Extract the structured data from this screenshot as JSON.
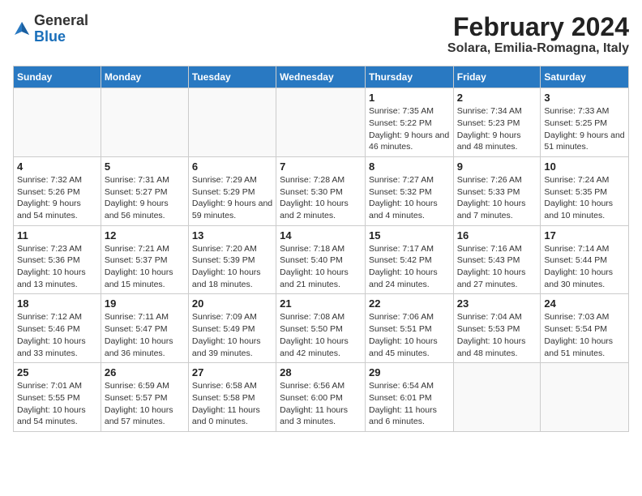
{
  "logo": {
    "general": "General",
    "blue": "Blue"
  },
  "header": {
    "month_year": "February 2024",
    "location": "Solara, Emilia-Romagna, Italy"
  },
  "weekdays": [
    "Sunday",
    "Monday",
    "Tuesday",
    "Wednesday",
    "Thursday",
    "Friday",
    "Saturday"
  ],
  "weeks": [
    [
      {
        "day": "",
        "info": ""
      },
      {
        "day": "",
        "info": ""
      },
      {
        "day": "",
        "info": ""
      },
      {
        "day": "",
        "info": ""
      },
      {
        "day": "1",
        "info": "Sunrise: 7:35 AM\nSunset: 5:22 PM\nDaylight: 9 hours and 46 minutes."
      },
      {
        "day": "2",
        "info": "Sunrise: 7:34 AM\nSunset: 5:23 PM\nDaylight: 9 hours and 48 minutes."
      },
      {
        "day": "3",
        "info": "Sunrise: 7:33 AM\nSunset: 5:25 PM\nDaylight: 9 hours and 51 minutes."
      }
    ],
    [
      {
        "day": "4",
        "info": "Sunrise: 7:32 AM\nSunset: 5:26 PM\nDaylight: 9 hours and 54 minutes."
      },
      {
        "day": "5",
        "info": "Sunrise: 7:31 AM\nSunset: 5:27 PM\nDaylight: 9 hours and 56 minutes."
      },
      {
        "day": "6",
        "info": "Sunrise: 7:29 AM\nSunset: 5:29 PM\nDaylight: 9 hours and 59 minutes."
      },
      {
        "day": "7",
        "info": "Sunrise: 7:28 AM\nSunset: 5:30 PM\nDaylight: 10 hours and 2 minutes."
      },
      {
        "day": "8",
        "info": "Sunrise: 7:27 AM\nSunset: 5:32 PM\nDaylight: 10 hours and 4 minutes."
      },
      {
        "day": "9",
        "info": "Sunrise: 7:26 AM\nSunset: 5:33 PM\nDaylight: 10 hours and 7 minutes."
      },
      {
        "day": "10",
        "info": "Sunrise: 7:24 AM\nSunset: 5:35 PM\nDaylight: 10 hours and 10 minutes."
      }
    ],
    [
      {
        "day": "11",
        "info": "Sunrise: 7:23 AM\nSunset: 5:36 PM\nDaylight: 10 hours and 13 minutes."
      },
      {
        "day": "12",
        "info": "Sunrise: 7:21 AM\nSunset: 5:37 PM\nDaylight: 10 hours and 15 minutes."
      },
      {
        "day": "13",
        "info": "Sunrise: 7:20 AM\nSunset: 5:39 PM\nDaylight: 10 hours and 18 minutes."
      },
      {
        "day": "14",
        "info": "Sunrise: 7:18 AM\nSunset: 5:40 PM\nDaylight: 10 hours and 21 minutes."
      },
      {
        "day": "15",
        "info": "Sunrise: 7:17 AM\nSunset: 5:42 PM\nDaylight: 10 hours and 24 minutes."
      },
      {
        "day": "16",
        "info": "Sunrise: 7:16 AM\nSunset: 5:43 PM\nDaylight: 10 hours and 27 minutes."
      },
      {
        "day": "17",
        "info": "Sunrise: 7:14 AM\nSunset: 5:44 PM\nDaylight: 10 hours and 30 minutes."
      }
    ],
    [
      {
        "day": "18",
        "info": "Sunrise: 7:12 AM\nSunset: 5:46 PM\nDaylight: 10 hours and 33 minutes."
      },
      {
        "day": "19",
        "info": "Sunrise: 7:11 AM\nSunset: 5:47 PM\nDaylight: 10 hours and 36 minutes."
      },
      {
        "day": "20",
        "info": "Sunrise: 7:09 AM\nSunset: 5:49 PM\nDaylight: 10 hours and 39 minutes."
      },
      {
        "day": "21",
        "info": "Sunrise: 7:08 AM\nSunset: 5:50 PM\nDaylight: 10 hours and 42 minutes."
      },
      {
        "day": "22",
        "info": "Sunrise: 7:06 AM\nSunset: 5:51 PM\nDaylight: 10 hours and 45 minutes."
      },
      {
        "day": "23",
        "info": "Sunrise: 7:04 AM\nSunset: 5:53 PM\nDaylight: 10 hours and 48 minutes."
      },
      {
        "day": "24",
        "info": "Sunrise: 7:03 AM\nSunset: 5:54 PM\nDaylight: 10 hours and 51 minutes."
      }
    ],
    [
      {
        "day": "25",
        "info": "Sunrise: 7:01 AM\nSunset: 5:55 PM\nDaylight: 10 hours and 54 minutes."
      },
      {
        "day": "26",
        "info": "Sunrise: 6:59 AM\nSunset: 5:57 PM\nDaylight: 10 hours and 57 minutes."
      },
      {
        "day": "27",
        "info": "Sunrise: 6:58 AM\nSunset: 5:58 PM\nDaylight: 11 hours and 0 minutes."
      },
      {
        "day": "28",
        "info": "Sunrise: 6:56 AM\nSunset: 6:00 PM\nDaylight: 11 hours and 3 minutes."
      },
      {
        "day": "29",
        "info": "Sunrise: 6:54 AM\nSunset: 6:01 PM\nDaylight: 11 hours and 6 minutes."
      },
      {
        "day": "",
        "info": ""
      },
      {
        "day": "",
        "info": ""
      }
    ]
  ]
}
